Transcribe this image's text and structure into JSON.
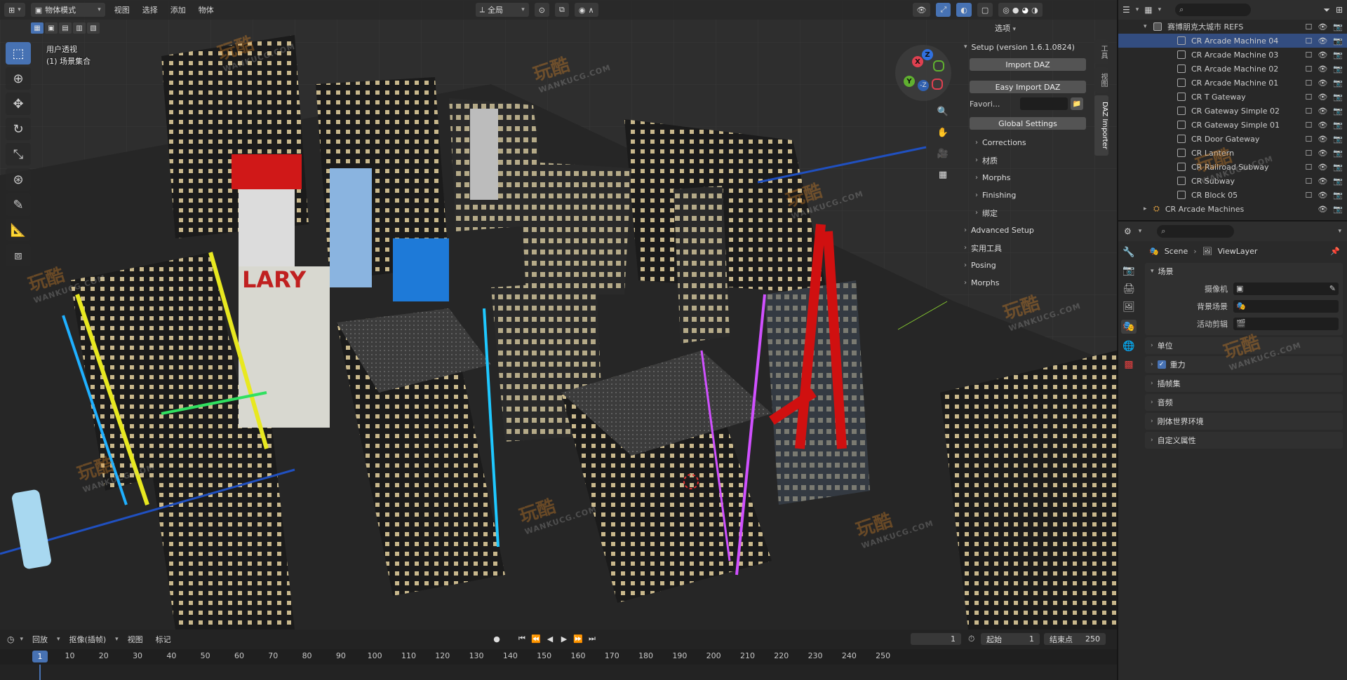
{
  "viewport": {
    "mode_label": "物体模式",
    "menus": [
      "视图",
      "选择",
      "添加",
      "物体"
    ],
    "transform_orientation": "全局",
    "options_label": "选项",
    "view_name": "用户透视",
    "collection_name": "(1) 场景集合",
    "gizmo_axes": [
      "X",
      "Y",
      "Z",
      "-Z"
    ],
    "icons": {
      "editor_type": "viewport-editor-icon",
      "select": "select-box-icon",
      "cursor": "cursor-icon",
      "move": "move-icon",
      "rotate": "rotate-icon",
      "scale": "scale-icon",
      "transform": "transform-icon",
      "annotate": "annotate-icon",
      "measure": "measure-icon",
      "add_cube": "add-cube-icon"
    }
  },
  "scene_text": {
    "billboard_lary": "LARY"
  },
  "npanel": {
    "setup_title": "Setup (version 1.6.1.0824)",
    "import_daz": "Import DAZ",
    "easy_import_daz": "Easy Import DAZ",
    "favorites_label": "Favori...",
    "global_settings": "Global Settings",
    "sub_items": [
      "Corrections",
      "材质",
      "Morphs",
      "Finishing",
      "绑定"
    ],
    "sections": [
      "Advanced Setup",
      "实用工具",
      "Posing",
      "Morphs"
    ],
    "tabs": [
      "工具",
      "视图",
      "DAZ Importer"
    ]
  },
  "timeline": {
    "menus": [
      "回放",
      "抠像(插帧)",
      "视图",
      "标记"
    ],
    "current_frame": "1",
    "start_label": "起始",
    "start_value": "1",
    "end_label": "结束点",
    "end_value": "250",
    "ticks": [
      "10",
      "20",
      "30",
      "40",
      "50",
      "60",
      "70",
      "80",
      "90",
      "100",
      "110",
      "120",
      "130",
      "140",
      "150",
      "160",
      "170",
      "180",
      "190",
      "200",
      "210",
      "220",
      "230",
      "240",
      "250"
    ]
  },
  "outliner": {
    "rows": [
      {
        "label": "赛博朋克大城市 REFS",
        "level": 1,
        "type": "collection"
      },
      {
        "label": "CR Arcade Machine 04",
        "level": 2,
        "type": "object",
        "selected": true
      },
      {
        "label": "CR Arcade Machine 03",
        "level": 2,
        "type": "object"
      },
      {
        "label": "CR Arcade Machine 02",
        "level": 2,
        "type": "object"
      },
      {
        "label": "CR Arcade Machine 01",
        "level": 2,
        "type": "object"
      },
      {
        "label": "CR T Gateway",
        "level": 2,
        "type": "object"
      },
      {
        "label": "CR Gateway Simple 02",
        "level": 2,
        "type": "object"
      },
      {
        "label": "CR Gateway Simple 01",
        "level": 2,
        "type": "object"
      },
      {
        "label": "CR Door Gateway",
        "level": 2,
        "type": "object"
      },
      {
        "label": "CR Lantern",
        "level": 2,
        "type": "object"
      },
      {
        "label": "CR Railroad Subway",
        "level": 2,
        "type": "object"
      },
      {
        "label": "CR Subway",
        "level": 2,
        "type": "object"
      },
      {
        "label": "CR Block 05",
        "level": 2,
        "type": "object"
      },
      {
        "label": "CR Arcade Machines",
        "level": 1,
        "type": "armature"
      }
    ]
  },
  "properties": {
    "breadcrumb_scene": "Scene",
    "breadcrumb_layer": "ViewLayer",
    "panel_scene": "场景",
    "camera_label": "摄像机",
    "background_label": "背景场景",
    "active_clip_label": "活动剪辑",
    "collapsed_panels": [
      "单位",
      "重力",
      "插帧集",
      "音频",
      "刚体世界环境",
      "自定义属性"
    ],
    "gravity_checked": true
  },
  "watermark": {
    "text": "玩酷",
    "url": "WANKUCG.COM"
  }
}
